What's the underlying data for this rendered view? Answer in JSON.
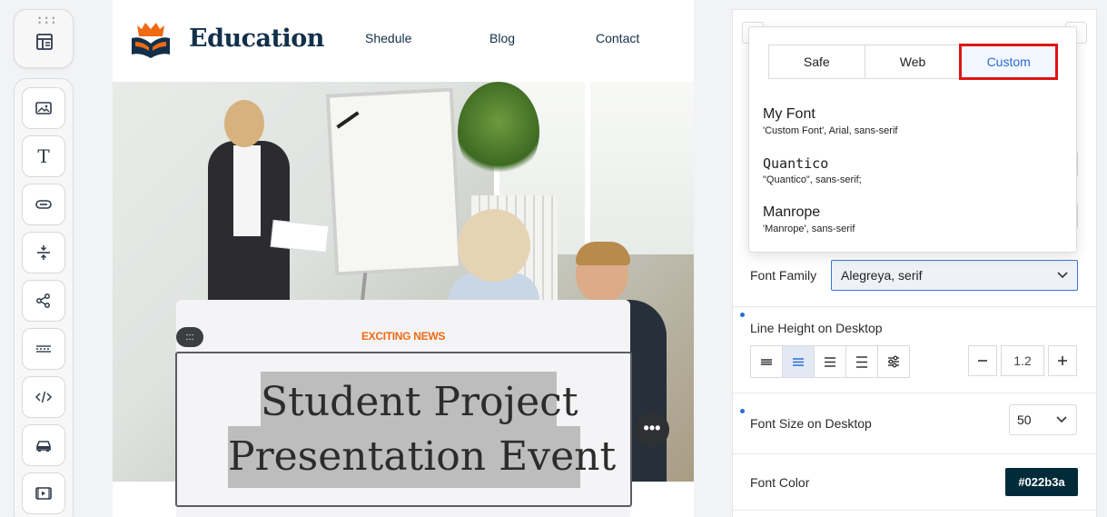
{
  "toolbar": {
    "top_icon": "layout-icon",
    "items": [
      {
        "icon": "image-icon"
      },
      {
        "icon": "text-icon"
      },
      {
        "icon": "button-icon"
      },
      {
        "icon": "spacer-icon"
      },
      {
        "icon": "share-icon"
      },
      {
        "icon": "divider-icon"
      },
      {
        "icon": "code-icon"
      },
      {
        "icon": "car-icon"
      },
      {
        "icon": "video-icon"
      }
    ]
  },
  "site": {
    "brand": "Education",
    "nav": [
      "Shedule",
      "Blog",
      "Contact"
    ],
    "kicker": "EXCITING NEWS",
    "title_line1": "Student Project",
    "title_line2": "Presentation Event",
    "drag_label": ":::",
    "more_label": "•••"
  },
  "font_popup": {
    "tabs": [
      "Safe",
      "Web",
      "Custom"
    ],
    "active_tab": "Custom",
    "fonts": [
      {
        "name": "My Font",
        "stack": "'Custom Font', Arial, sans-serif"
      },
      {
        "name": "Quantico",
        "stack": "\"Quantico\", sans-serif;"
      },
      {
        "name": "Manrope",
        "stack": "'Manrope', sans-serif"
      }
    ]
  },
  "settings": {
    "font_family_label": "Font Family",
    "font_family_value": "Alegreya, serif",
    "line_height_label": "Line Height on Desktop",
    "line_height_value": "1.2",
    "font_size_label": "Font Size on Desktop",
    "font_size_value": "50",
    "font_color_label": "Font Color",
    "font_color_value": "#022b3a"
  },
  "colors": {
    "accent": "#2a6cd6",
    "highlight_border": "#e01414",
    "kicker": "#f06a12",
    "brand_text": "#12304a",
    "font_color": "#022b3a"
  }
}
